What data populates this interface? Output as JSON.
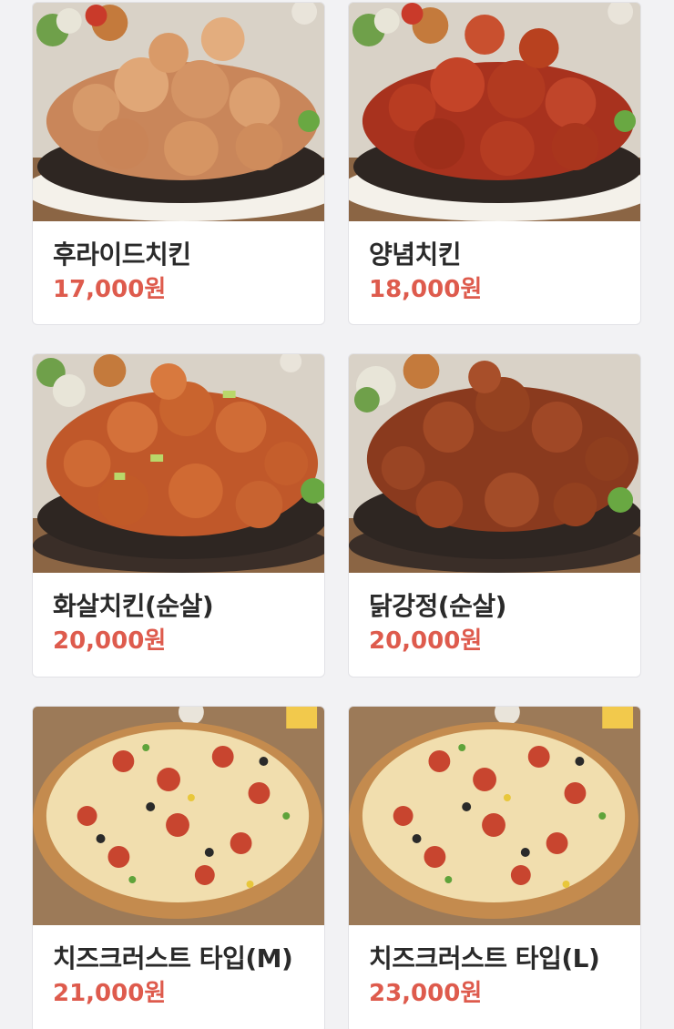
{
  "colors": {
    "price": "#de5b4d",
    "name": "#2a2a2a",
    "page_bg": "#f2f2f4",
    "card_bg": "#ffffff"
  },
  "menu": [
    {
      "name": "후라이드치킨",
      "price": "17,000원",
      "image": "fried-chicken"
    },
    {
      "name": "양념치킨",
      "price": "18,000원",
      "image": "seasoned-chicken"
    },
    {
      "name": "화살치킨(순살)",
      "price": "20,000원",
      "image": "hwasal-chicken"
    },
    {
      "name": "닭강정(순살)",
      "price": "20,000원",
      "image": "dakgangjeong"
    },
    {
      "name": "치즈크러스트 타입(M)",
      "price": "21,000원",
      "image": "cheese-crust-pizza"
    },
    {
      "name": "치즈크러스트 타입(L)",
      "price": "23,000원",
      "image": "cheese-crust-pizza"
    }
  ]
}
